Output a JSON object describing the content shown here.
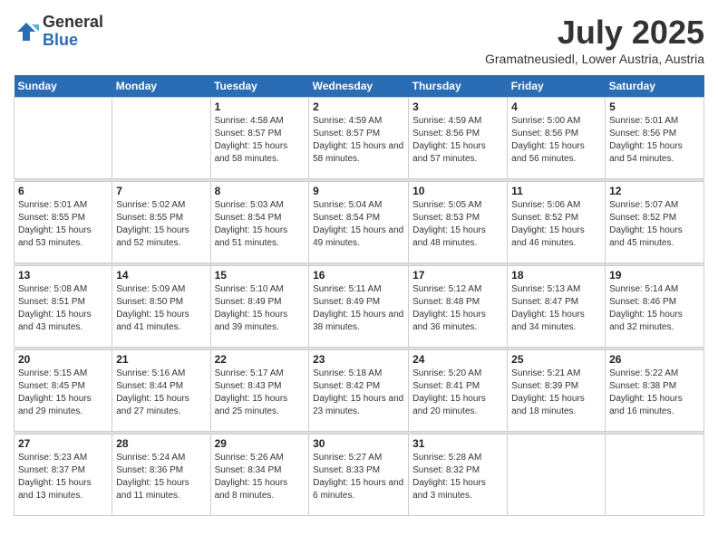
{
  "logo": {
    "general": "General",
    "blue": "Blue"
  },
  "title": {
    "month": "July 2025",
    "location": "Gramatneusiedl, Lower Austria, Austria"
  },
  "headers": [
    "Sunday",
    "Monday",
    "Tuesday",
    "Wednesday",
    "Thursday",
    "Friday",
    "Saturday"
  ],
  "weeks": [
    [
      {
        "day": "",
        "detail": ""
      },
      {
        "day": "",
        "detail": ""
      },
      {
        "day": "1",
        "detail": "Sunrise: 4:58 AM\nSunset: 8:57 PM\nDaylight: 15 hours and 58 minutes."
      },
      {
        "day": "2",
        "detail": "Sunrise: 4:59 AM\nSunset: 8:57 PM\nDaylight: 15 hours and 58 minutes."
      },
      {
        "day": "3",
        "detail": "Sunrise: 4:59 AM\nSunset: 8:56 PM\nDaylight: 15 hours and 57 minutes."
      },
      {
        "day": "4",
        "detail": "Sunrise: 5:00 AM\nSunset: 8:56 PM\nDaylight: 15 hours and 56 minutes."
      },
      {
        "day": "5",
        "detail": "Sunrise: 5:01 AM\nSunset: 8:56 PM\nDaylight: 15 hours and 54 minutes."
      }
    ],
    [
      {
        "day": "6",
        "detail": "Sunrise: 5:01 AM\nSunset: 8:55 PM\nDaylight: 15 hours and 53 minutes."
      },
      {
        "day": "7",
        "detail": "Sunrise: 5:02 AM\nSunset: 8:55 PM\nDaylight: 15 hours and 52 minutes."
      },
      {
        "day": "8",
        "detail": "Sunrise: 5:03 AM\nSunset: 8:54 PM\nDaylight: 15 hours and 51 minutes."
      },
      {
        "day": "9",
        "detail": "Sunrise: 5:04 AM\nSunset: 8:54 PM\nDaylight: 15 hours and 49 minutes."
      },
      {
        "day": "10",
        "detail": "Sunrise: 5:05 AM\nSunset: 8:53 PM\nDaylight: 15 hours and 48 minutes."
      },
      {
        "day": "11",
        "detail": "Sunrise: 5:06 AM\nSunset: 8:52 PM\nDaylight: 15 hours and 46 minutes."
      },
      {
        "day": "12",
        "detail": "Sunrise: 5:07 AM\nSunset: 8:52 PM\nDaylight: 15 hours and 45 minutes."
      }
    ],
    [
      {
        "day": "13",
        "detail": "Sunrise: 5:08 AM\nSunset: 8:51 PM\nDaylight: 15 hours and 43 minutes."
      },
      {
        "day": "14",
        "detail": "Sunrise: 5:09 AM\nSunset: 8:50 PM\nDaylight: 15 hours and 41 minutes."
      },
      {
        "day": "15",
        "detail": "Sunrise: 5:10 AM\nSunset: 8:49 PM\nDaylight: 15 hours and 39 minutes."
      },
      {
        "day": "16",
        "detail": "Sunrise: 5:11 AM\nSunset: 8:49 PM\nDaylight: 15 hours and 38 minutes."
      },
      {
        "day": "17",
        "detail": "Sunrise: 5:12 AM\nSunset: 8:48 PM\nDaylight: 15 hours and 36 minutes."
      },
      {
        "day": "18",
        "detail": "Sunrise: 5:13 AM\nSunset: 8:47 PM\nDaylight: 15 hours and 34 minutes."
      },
      {
        "day": "19",
        "detail": "Sunrise: 5:14 AM\nSunset: 8:46 PM\nDaylight: 15 hours and 32 minutes."
      }
    ],
    [
      {
        "day": "20",
        "detail": "Sunrise: 5:15 AM\nSunset: 8:45 PM\nDaylight: 15 hours and 29 minutes."
      },
      {
        "day": "21",
        "detail": "Sunrise: 5:16 AM\nSunset: 8:44 PM\nDaylight: 15 hours and 27 minutes."
      },
      {
        "day": "22",
        "detail": "Sunrise: 5:17 AM\nSunset: 8:43 PM\nDaylight: 15 hours and 25 minutes."
      },
      {
        "day": "23",
        "detail": "Sunrise: 5:18 AM\nSunset: 8:42 PM\nDaylight: 15 hours and 23 minutes."
      },
      {
        "day": "24",
        "detail": "Sunrise: 5:20 AM\nSunset: 8:41 PM\nDaylight: 15 hours and 20 minutes."
      },
      {
        "day": "25",
        "detail": "Sunrise: 5:21 AM\nSunset: 8:39 PM\nDaylight: 15 hours and 18 minutes."
      },
      {
        "day": "26",
        "detail": "Sunrise: 5:22 AM\nSunset: 8:38 PM\nDaylight: 15 hours and 16 minutes."
      }
    ],
    [
      {
        "day": "27",
        "detail": "Sunrise: 5:23 AM\nSunset: 8:37 PM\nDaylight: 15 hours and 13 minutes."
      },
      {
        "day": "28",
        "detail": "Sunrise: 5:24 AM\nSunset: 8:36 PM\nDaylight: 15 hours and 11 minutes."
      },
      {
        "day": "29",
        "detail": "Sunrise: 5:26 AM\nSunset: 8:34 PM\nDaylight: 15 hours and 8 minutes."
      },
      {
        "day": "30",
        "detail": "Sunrise: 5:27 AM\nSunset: 8:33 PM\nDaylight: 15 hours and 6 minutes."
      },
      {
        "day": "31",
        "detail": "Sunrise: 5:28 AM\nSunset: 8:32 PM\nDaylight: 15 hours and 3 minutes."
      },
      {
        "day": "",
        "detail": ""
      },
      {
        "day": "",
        "detail": ""
      }
    ]
  ]
}
